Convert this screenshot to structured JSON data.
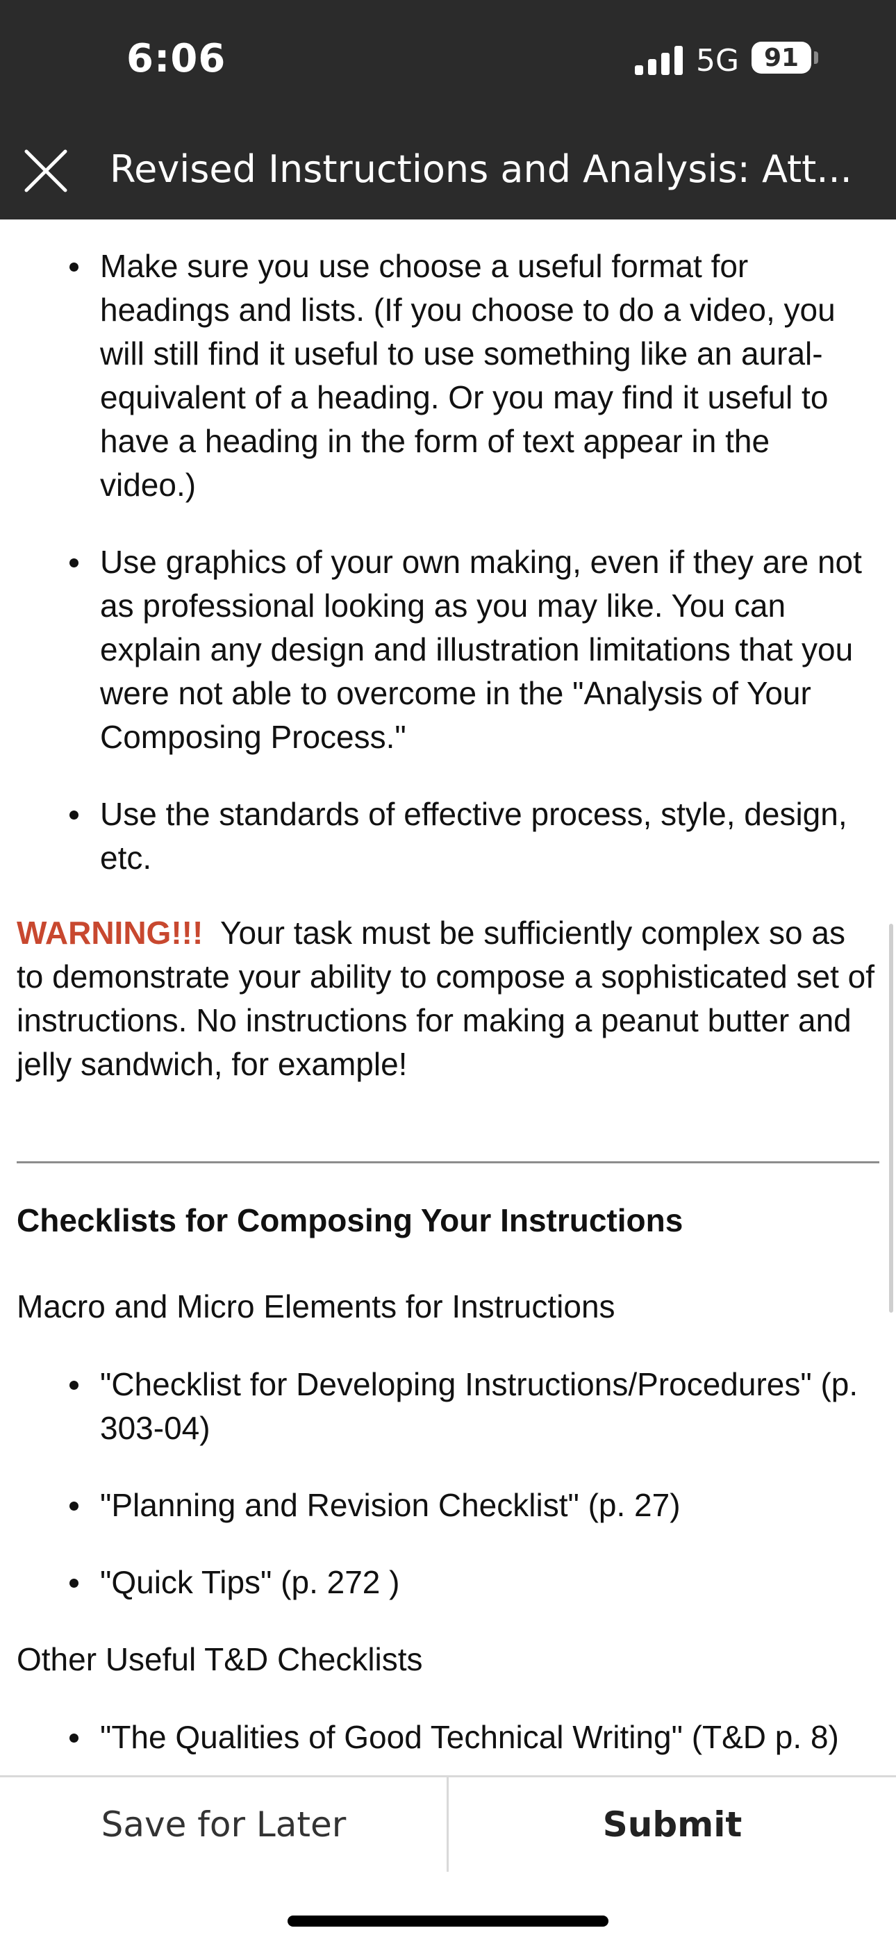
{
  "status_bar": {
    "time": "6:06",
    "network": "5G",
    "battery": "91"
  },
  "header": {
    "title": "Revised Instructions and Analysis: Att..."
  },
  "content": {
    "top_bullets": [
      "Make sure you use choose a useful format for headings and lists. (If you choose to do a video, you will still find it useful to use something like an aural-equivalent of a heading. Or you may find it useful to have a heading in the form of text appear in the video.)",
      "Use graphics of your own making, even if they are not as professional looking as you may like. You can explain any design and illustration limitations that you were not able to overcome in the \"Analysis of Your Composing Process.\"",
      "Use the standards of effective process, style, design, etc."
    ],
    "warning_label": "WARNING!!!",
    "warning_text": "Your task must be sufficiently complex so as to demonstrate your ability to compose a sophisticated set of instructions. No instructions for making a peanut butter and jelly sandwich, for example!",
    "checklist_heading": "Checklists for Composing Your Instructions",
    "macro_heading": "Macro and Micro Elements for Instructions",
    "macro_items": [
      "\"Checklist for Developing Instructions/Procedures\" (p. 303-04)",
      "\"Planning and Revision Checklist\" (p. 27)",
      "\"Quick Tips\" (p. 272 )"
    ],
    "other_heading": "Other Useful T&D Checklists",
    "other_items": [
      "\"The Qualities of Good Technical Writing\" (T&D p. 8)"
    ]
  },
  "footer": {
    "save_label": "Save for Later",
    "submit_label": "Submit"
  },
  "colors": {
    "header_bg": "#2b2b2b",
    "warning": "#c8482f"
  }
}
